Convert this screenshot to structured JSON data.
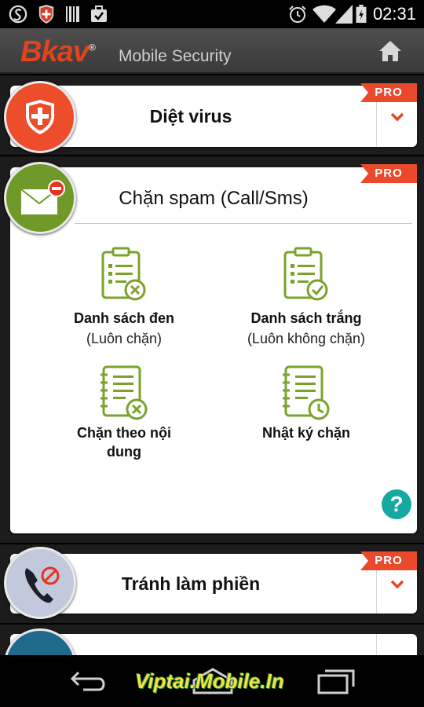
{
  "status_bar": {
    "time": "02:31",
    "left_icons": [
      "s-logo-icon",
      "bkav-shield-icon",
      "barcode-icon",
      "briefcase-check-icon"
    ],
    "right_icons": [
      "alarm-icon",
      "wifi-icon",
      "signal-icon",
      "battery-icon"
    ]
  },
  "app_bar": {
    "brand": "Bkav",
    "brand_mark": "®",
    "subtitle": "Mobile Security",
    "home_icon": "home-icon"
  },
  "colors": {
    "brand_red": "#e2431e",
    "pro_badge": "#ea4a2b",
    "feature_green": "#7aa32c",
    "help_teal": "#16a8a1"
  },
  "modules": [
    {
      "title": "Diệt virus",
      "badge": "PRO",
      "icon": "shield-plus-icon",
      "expanded": false
    },
    {
      "title_main": "Chặn spam",
      "title_paren": "(Call/Sms)",
      "badge": "PRO",
      "icon": "mail-block-icon",
      "expanded": true,
      "features": [
        {
          "label": "Danh sách đen",
          "sub": "(Luôn chặn)",
          "icon": "blacklist-clipboard-icon"
        },
        {
          "label": "Danh sách trắng",
          "sub": "(Luôn không chặn)",
          "icon": "whitelist-clipboard-icon"
        },
        {
          "label_line1": "Chặn theo nội",
          "label_line2": "dung",
          "icon": "content-block-notebook-icon"
        },
        {
          "label": "Nhật ký chặn",
          "icon": "block-log-notebook-icon"
        }
      ],
      "help_label": "?"
    },
    {
      "title": "Tránh làm phiền",
      "badge": "PRO",
      "icon": "phone-block-icon",
      "expanded": false
    }
  ],
  "nav_bar": {
    "back_icon": "back-icon",
    "home_icon": "nav-home-icon",
    "recents_icon": "recents-icon",
    "watermark": "Viptai.Mobile.In"
  }
}
